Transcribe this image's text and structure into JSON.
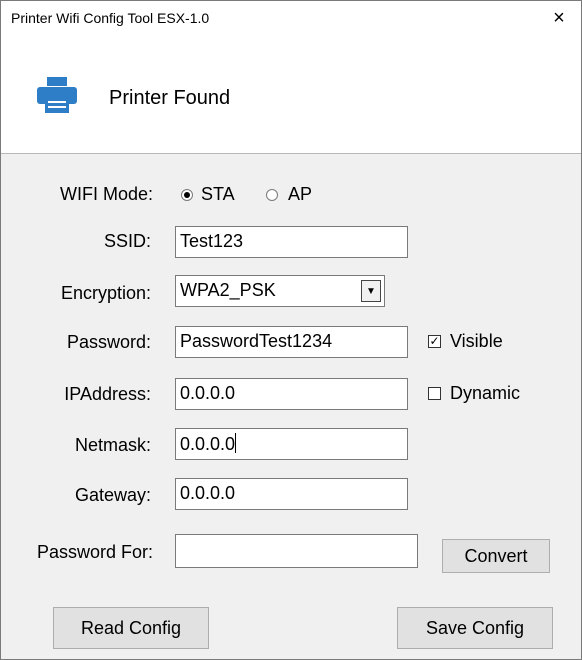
{
  "window": {
    "title": "Printer Wifi Config Tool ESX-1.0",
    "close_glyph": "×"
  },
  "banner": {
    "icon": "printer-icon",
    "icon_color": "#2e7dc7",
    "text": "Printer Found"
  },
  "form": {
    "wifi_mode": {
      "label": "WIFI Mode:",
      "options": [
        "STA",
        "AP"
      ],
      "selected": "STA"
    },
    "ssid": {
      "label": "SSID:",
      "value": "Test123"
    },
    "encryption": {
      "label": "Encryption:",
      "value": "WPA2_PSK"
    },
    "password": {
      "label": "Password:",
      "value": "PasswordTest1234"
    },
    "visible": {
      "label": "Visible",
      "checked": true
    },
    "ip_address": {
      "label": "IPAddress:",
      "value": "0.0.0.0"
    },
    "dynamic": {
      "label": "Dynamic",
      "checked": false
    },
    "netmask": {
      "label": "Netmask:",
      "value": "0.0.0.0"
    },
    "gateway": {
      "label": "Gateway:",
      "value": "0.0.0.0"
    },
    "password_for": {
      "label": "Password For:",
      "value": ""
    }
  },
  "buttons": {
    "convert": "Convert",
    "read_config": "Read Config",
    "save_config": "Save Config"
  }
}
